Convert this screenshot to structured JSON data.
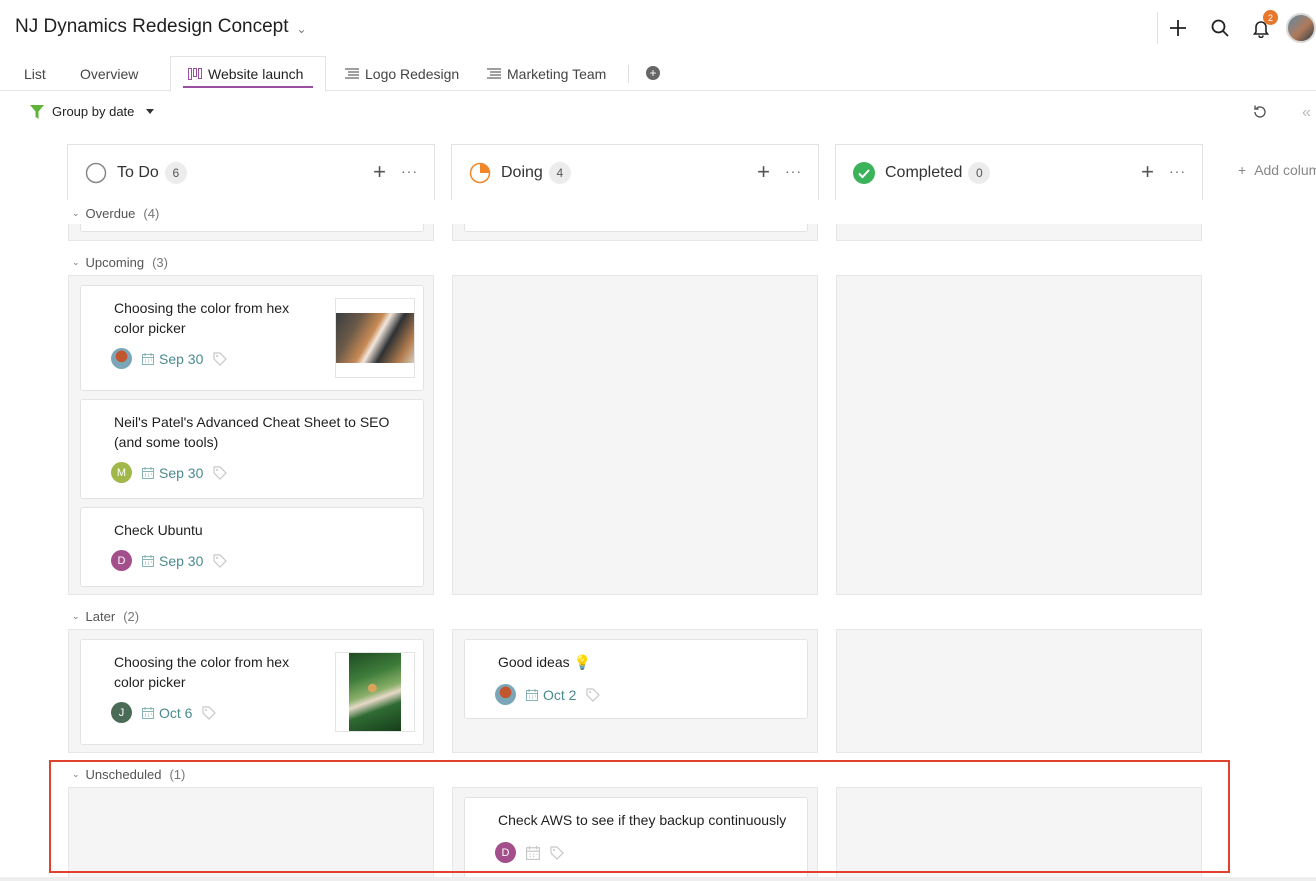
{
  "header": {
    "project_title": "NJ Dynamics Redesign Concept",
    "notification_count": "2"
  },
  "tabs": [
    {
      "label": "List"
    },
    {
      "label": "Overview"
    },
    {
      "label": "Website launch"
    },
    {
      "label": "Logo Redesign"
    },
    {
      "label": "Marketing Team"
    }
  ],
  "toolbar": {
    "group_by_label": "Group by date"
  },
  "columns": [
    {
      "name": "To Do",
      "count": "6"
    },
    {
      "name": "Doing",
      "count": "4"
    },
    {
      "name": "Completed",
      "count": "0"
    }
  ],
  "add_column_label": "Add column",
  "groups": {
    "overdue": {
      "label": "Overdue",
      "count": "(4)"
    },
    "upcoming": {
      "label": "Upcoming",
      "count": "(3)"
    },
    "later": {
      "label": "Later",
      "count": "(2)"
    },
    "unscheduled": {
      "label": "Unscheduled",
      "count": "(1)"
    }
  },
  "cards": {
    "up1": {
      "title_line1": "Choosing the color from hex",
      "title_line2": "color picker",
      "date": "Sep 30"
    },
    "up2": {
      "title_line1": "Neil's Patel's Advanced Cheat Sheet to SEO",
      "title_line2": "(and some tools)",
      "avatar": "M",
      "date": "Sep 30"
    },
    "up3": {
      "title_line1": "Check Ubuntu",
      "avatar": "D",
      "date": "Sep 30"
    },
    "later1": {
      "title_line1": "Choosing the color from hex",
      "title_line2": "color picker",
      "avatar": "J",
      "date": "Oct 6"
    },
    "later2": {
      "title_line1": "Good ideas",
      "date": "Oct 2"
    },
    "uns1": {
      "title_line1": "Check AWS to see if they backup continuously",
      "avatar": "D"
    }
  },
  "colors": {
    "accent": "#9b4fa3",
    "date_teal": "#4b8a8f",
    "completed_green": "#3bb35a",
    "doing_orange": "#f0872a",
    "filter_green": "#5fb336",
    "highlight_red": "#e0412f"
  }
}
